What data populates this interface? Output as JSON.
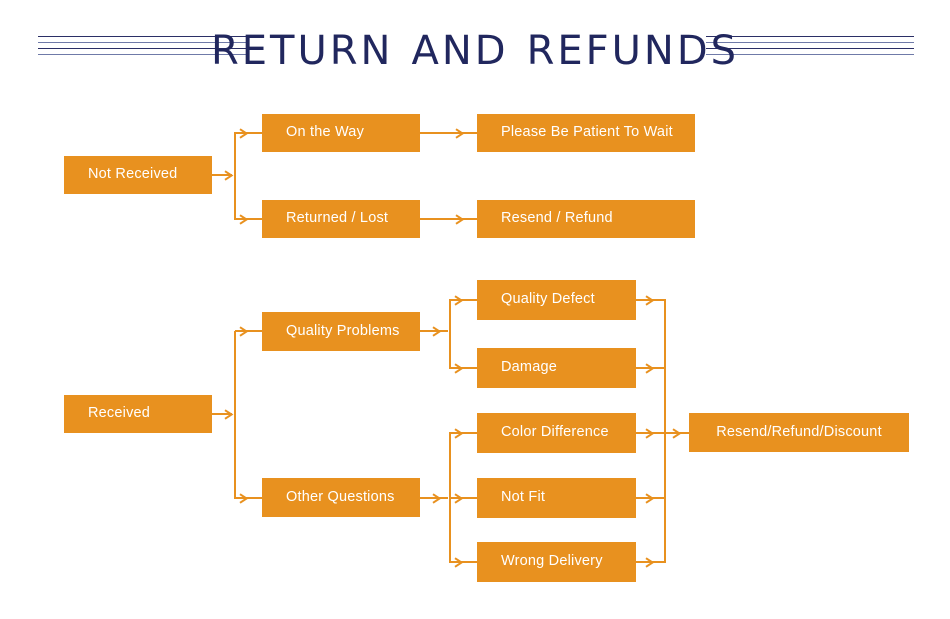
{
  "page": {
    "title": "RETURN AND REFUNDS",
    "title_words": [
      "RETURN",
      "AND",
      "REFUNDS"
    ],
    "background_color": "#ffffff",
    "title_color": "#21275e",
    "rule_color": "#2b2f66",
    "node_color": "#e8911f",
    "node_text_color": "#ffffff",
    "connector_color": "#e8911f"
  },
  "flowchart": {
    "type": "diagram",
    "branches": [
      {
        "id": "not-received",
        "root": {
          "label": "Not Received"
        },
        "children": [
          {
            "label": "On the Way",
            "children": [
              {
                "label": "Please Be Patient To Wait"
              }
            ]
          },
          {
            "label": "Returned / Lost",
            "children": [
              {
                "label": "Resend / Refund"
              }
            ]
          }
        ]
      },
      {
        "id": "received",
        "root": {
          "label": "Received"
        },
        "children": [
          {
            "label": "Quality Problems",
            "children": [
              {
                "label": "Quality Defect"
              },
              {
                "label": "Damage"
              }
            ]
          },
          {
            "label": "Other Questions",
            "children": [
              {
                "label": "Color Difference"
              },
              {
                "label": "Not Fit"
              },
              {
                "label": "Wrong Delivery"
              }
            ]
          }
        ],
        "outcome": {
          "label": "Resend/Refund/Discount"
        }
      }
    ],
    "nodes": {
      "not_received": "Not Received",
      "on_the_way": "On the Way",
      "returned_lost": "Returned / Lost",
      "please_be_patient": "Please Be Patient To Wait",
      "resend_refund": "Resend / Refund",
      "received": "Received",
      "quality_problems": "Quality Problems",
      "other_questions": "Other Questions",
      "quality_defect": "Quality Defect",
      "damage": "Damage",
      "color_difference": "Color Difference",
      "not_fit": "Not Fit",
      "wrong_delivery": "Wrong Delivery",
      "resend_refund_discount": "Resend/Refund/Discount"
    }
  }
}
